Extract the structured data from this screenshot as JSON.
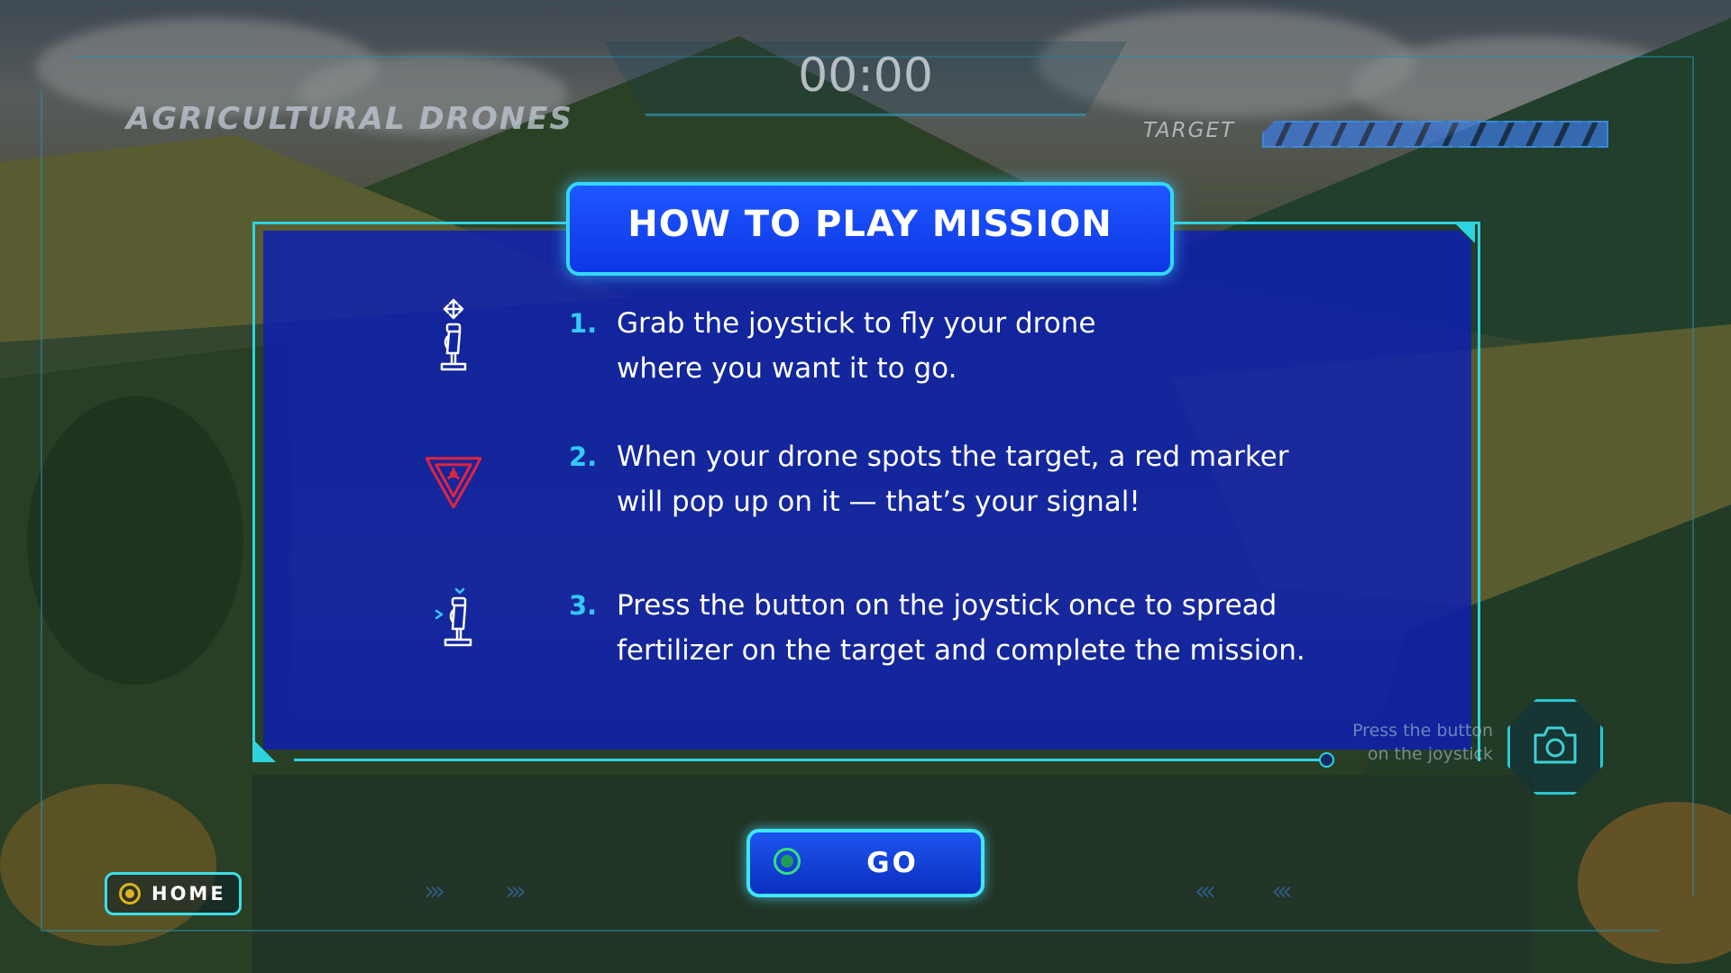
{
  "game": {
    "title": "AGRICULTURAL DRONES"
  },
  "hud": {
    "timer": "00:00",
    "target_label": "TARGET",
    "target_progress": 1.0
  },
  "panel": {
    "title": "HOW TO PLAY MISSION",
    "steps": [
      {
        "number": "1.",
        "line1": "Grab the joystick to fly your drone",
        "line2": "where you want it to go.",
        "icon": "joystick-move-icon"
      },
      {
        "number": "2.",
        "line1": "When your drone spots the target, a red marker",
        "line2": "will pop up on it — that’s your signal!",
        "icon": "target-marker-icon"
      },
      {
        "number": "3.",
        "line1": "Press the button on the joystick once to spread",
        "line2": "fertilizer on the target and complete the mission.",
        "icon": "joystick-button-icon"
      }
    ]
  },
  "controls": {
    "go_label": "GO",
    "home_label": "HOME",
    "camera_hint_line1": "Press the button",
    "camera_hint_line2": "on the joystick"
  },
  "colors": {
    "accent_cyan": "#2fd3e0",
    "panel_blue": "#0c1eb4",
    "step_number": "#34c9ff",
    "marker_red": "#e0243f",
    "go_indicator": "#36e07a",
    "home_indicator": "#e0b322"
  }
}
